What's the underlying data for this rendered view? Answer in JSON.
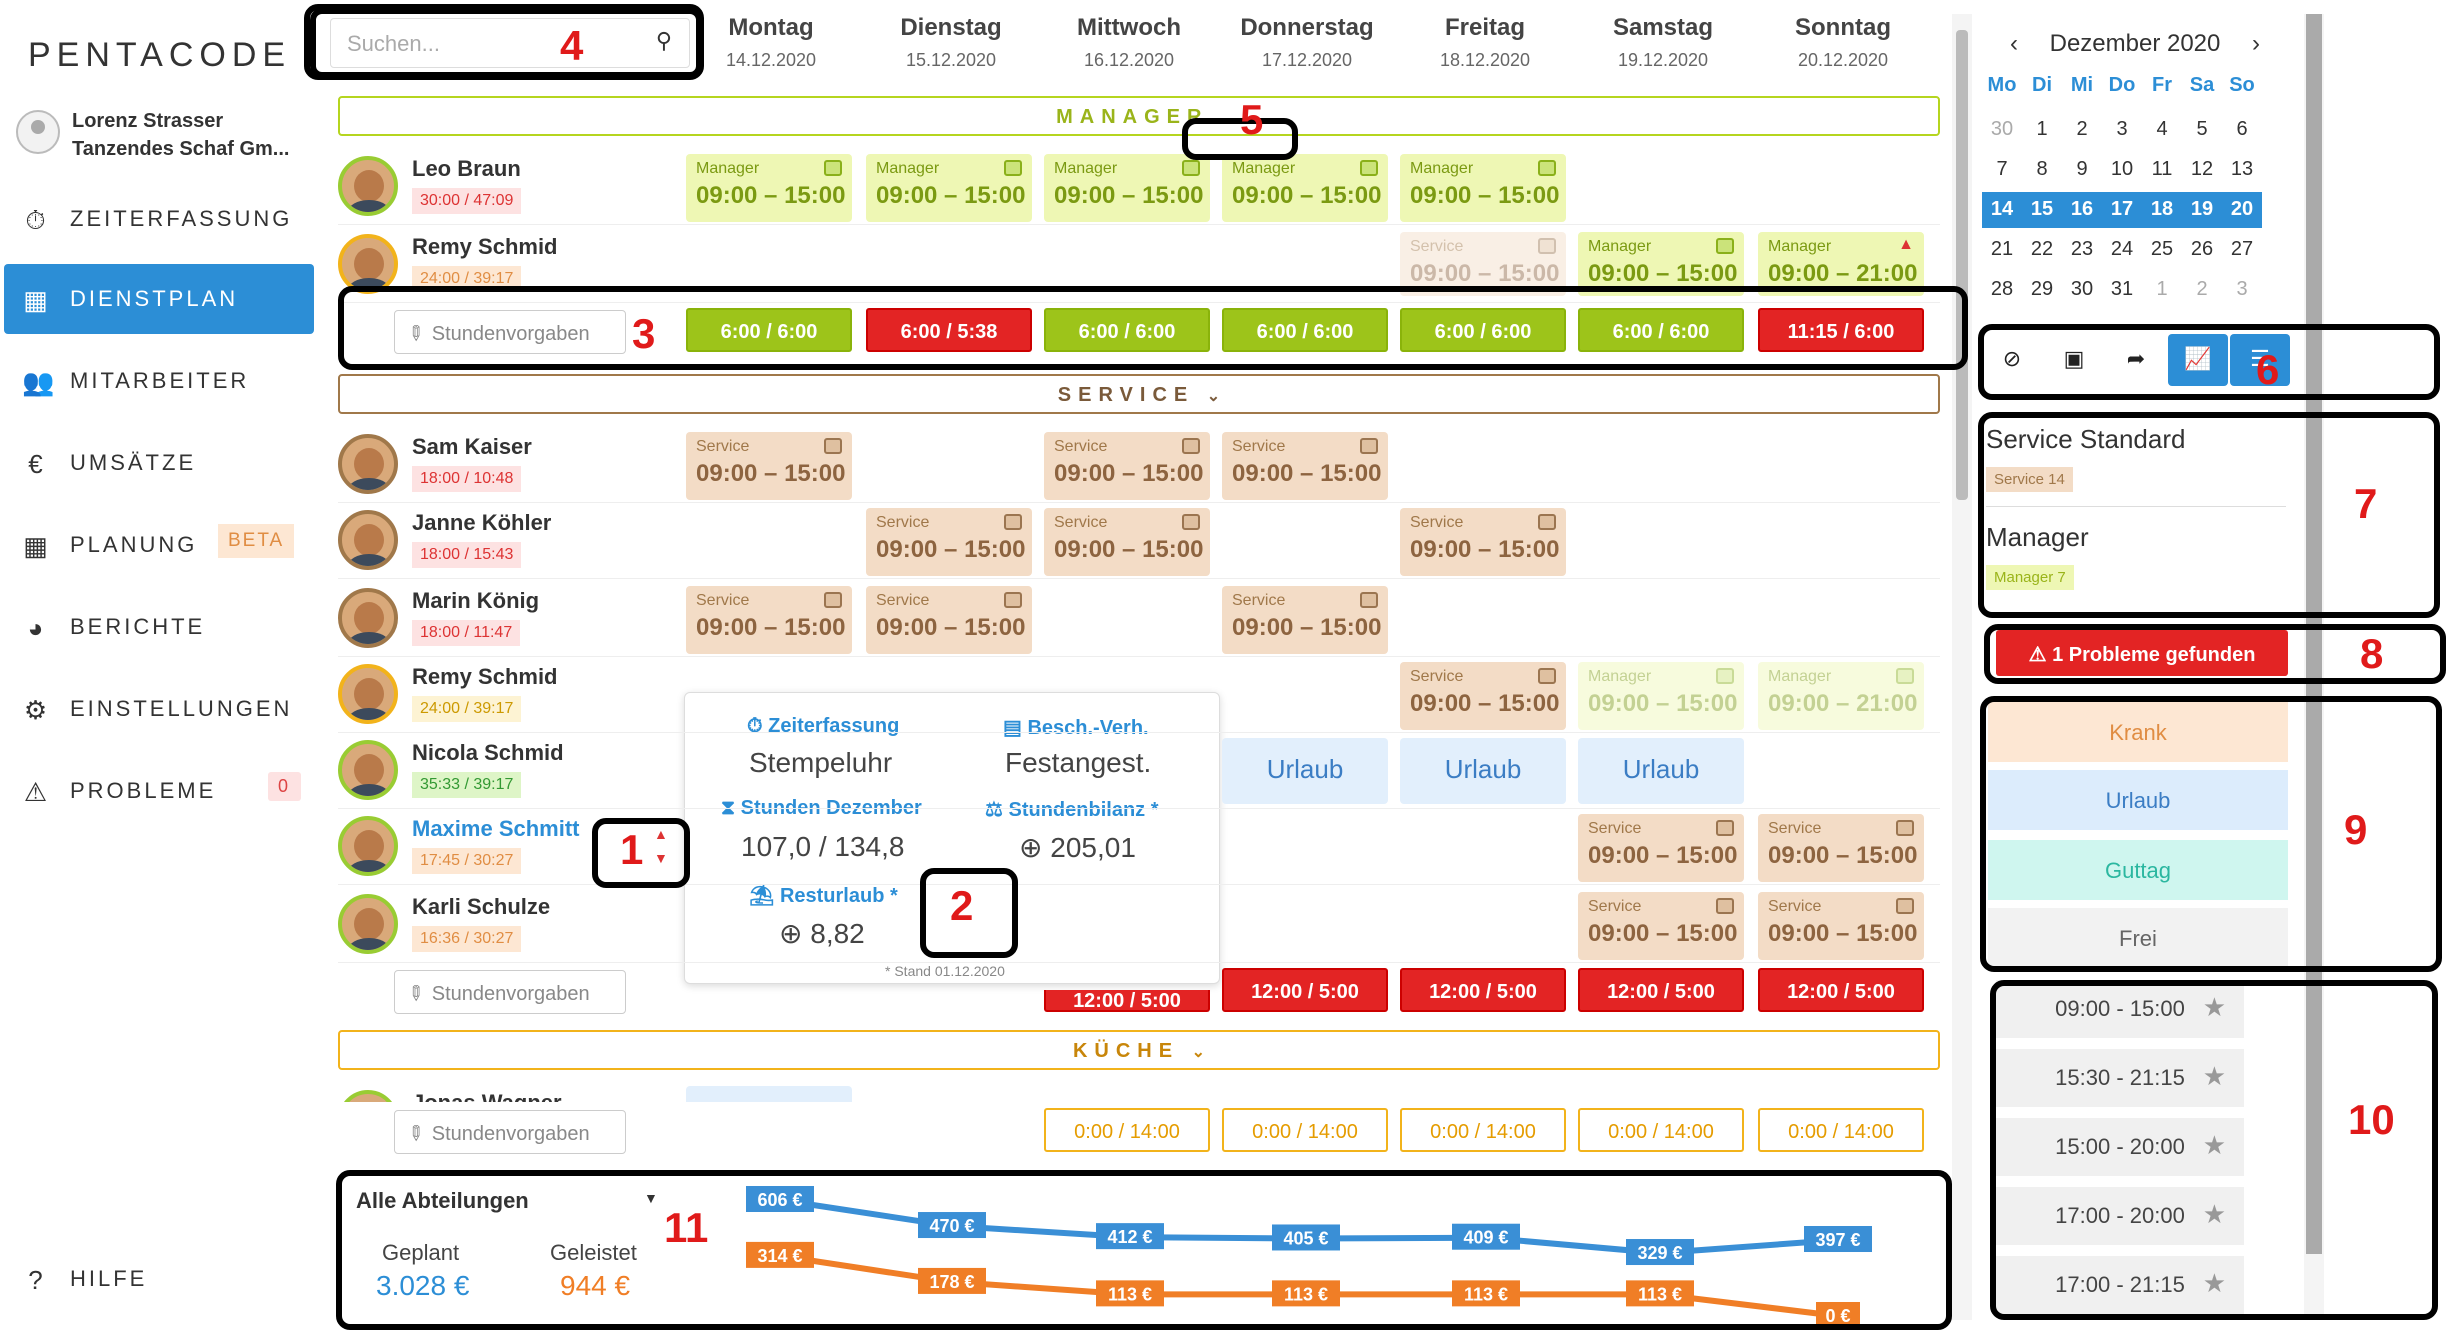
{
  "logo": "PENTACODE",
  "user": {
    "name": "Lorenz Strasser",
    "company": "Tanzendes Schaf Gm..."
  },
  "nav": [
    {
      "label": "ZEITERFASSUNG"
    },
    {
      "label": "DIENSTPLAN"
    },
    {
      "label": "MITARBEITER"
    },
    {
      "label": "UMSÄTZE"
    },
    {
      "label": "PLANUNG",
      "badge": "BETA"
    },
    {
      "label": "BERICHTE"
    },
    {
      "label": "EINSTELLUNGEN"
    },
    {
      "label": "PROBLEME",
      "count": "0"
    }
  ],
  "help": "HILFE",
  "search": {
    "placeholder": "Suchen..."
  },
  "days": [
    {
      "name": "Montag",
      "date": "14.12.2020"
    },
    {
      "name": "Dienstag",
      "date": "15.12.2020"
    },
    {
      "name": "Mittwoch",
      "date": "16.12.2020"
    },
    {
      "name": "Donnerstag",
      "date": "17.12.2020"
    },
    {
      "name": "Freitag",
      "date": "18.12.2020"
    },
    {
      "name": "Samstag",
      "date": "19.12.2020"
    },
    {
      "name": "Sonntag",
      "date": "20.12.2020"
    }
  ],
  "depts": {
    "manager": "MANAGER",
    "service": "SERVICE",
    "kueche": "KÜCHE",
    "chev": "⌄"
  },
  "stundenvorgaben": "Stundenvorgaben",
  "employees": [
    {
      "name": "Leo Braun",
      "hours": "30:00 / 47:09"
    },
    {
      "name": "Remy Schmid",
      "hours": "24:00 / 39:17"
    },
    {
      "name": "Sam Kaiser",
      "hours": "18:00 / 10:48"
    },
    {
      "name": "Janne Köhler",
      "hours": "18:00 / 15:43"
    },
    {
      "name": "Marin König",
      "hours": "18:00 / 11:47"
    },
    {
      "name": "Remy Schmid",
      "hours": "24:00 / 39:17"
    },
    {
      "name": "Nicola Schmid",
      "hours": "35:33 / 39:17"
    },
    {
      "name": "Maxime Schmitt",
      "hours": "17:45 / 30:27"
    },
    {
      "name": "Karli Schulze",
      "hours": "16:36 / 30:27"
    },
    {
      "name": "Jonas Wagner",
      "hours": ""
    }
  ],
  "shift": {
    "manager": "Manager",
    "service": "Service",
    "t1": "09:00 – 15:00",
    "t2": "09:00 – 21:00",
    "urlaub": "Urlaub"
  },
  "totals": {
    "manager": [
      "6:00 / 6:00",
      "6:00 / 5:38",
      "6:00 / 6:00",
      "6:00 / 6:00",
      "6:00 / 6:00",
      "6:00 / 6:00",
      "11:15 / 6:00"
    ],
    "service": [
      "12:00 / 5:00",
      "12:00 / 5:00",
      "12:00 / 5:00",
      "12:00 / 5:00",
      "12:00 / 5:00"
    ],
    "kueche": [
      "0:00 / 14:00",
      "0:00 / 14:00",
      "0:00 / 14:00",
      "0:00 / 14:00",
      "0:00 / 14:00"
    ]
  },
  "popup": {
    "zeit_h": "Zeiterfassung",
    "zeit_v": "Stempeluhr",
    "besch_h": "Besch.-Verh.",
    "besch_v": "Festangest.",
    "std_h": "Stunden Dezember",
    "std_v": "107,0 / 134,8",
    "bil_h": "Stundenbilanz *",
    "bil_v": "205,01",
    "rest_h": "Resturlaub *",
    "rest_v": "8,82",
    "foot": "* Stand 01.12.2020"
  },
  "chart": {
    "select": "Alle Abteilungen",
    "planned_label": "Geplant",
    "done_label": "Geleistet",
    "planned": "3.028 €",
    "done": "944 €"
  },
  "chart_data": {
    "type": "line",
    "series": [
      {
        "values": [
          606,
          470,
          412,
          405,
          409,
          329,
          397
        ]
      },
      {
        "values": [
          314,
          178,
          113,
          113,
          113,
          113,
          0
        ]
      }
    ]
  },
  "calendar": {
    "month": "Dezember 2020",
    "weekdays": [
      "Mo",
      "Di",
      "Mi",
      "Do",
      "Fr",
      "Sa",
      "So"
    ],
    "rows": [
      [
        "30",
        "1",
        "2",
        "3",
        "4",
        "5",
        "6"
      ],
      [
        "7",
        "8",
        "9",
        "10",
        "11",
        "12",
        "13"
      ],
      [
        "14",
        "15",
        "16",
        "17",
        "18",
        "19",
        "20"
      ],
      [
        "21",
        "22",
        "23",
        "24",
        "25",
        "26",
        "27"
      ],
      [
        "28",
        "29",
        "30",
        "31",
        "1",
        "2",
        "3"
      ]
    ]
  },
  "templates": [
    {
      "title": "Service Standard",
      "tag": "Service 14"
    },
    {
      "title": "Manager",
      "tag": "Manager 7"
    }
  ],
  "problems": "1 Probleme gefunden",
  "absences": [
    "Krank",
    "Urlaub",
    "Guttag",
    "Frei"
  ],
  "favorites": [
    "09:00 - 15:00",
    "15:30 - 21:15",
    "15:00 - 20:00",
    "17:00 - 20:00",
    "17:00 - 21:15"
  ],
  "markers": [
    "1",
    "2",
    "3",
    "4",
    "5",
    "6",
    "7",
    "8",
    "9",
    "10",
    "11"
  ],
  "colors": {
    "accent": "#2c8ed6",
    "manager": "#b5d51f",
    "service": "#a0784a",
    "kueche": "#f2b31b",
    "alert": "#e32424",
    "planned_line": "#3a8fd6",
    "done_line": "#f07e26"
  }
}
